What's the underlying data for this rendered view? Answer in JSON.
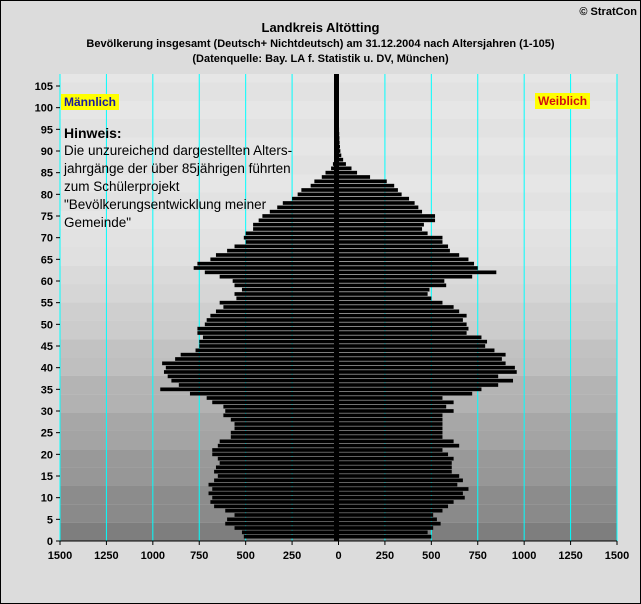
{
  "header": {
    "title": "Landkreis Altötting",
    "subtitle": "Bevölkerung  insgesamt (Deutsch+ Nichtdeutsch) am 31.12.2004 nach Altersjahren (1-105)",
    "source": "(Datenquelle: Bay. LA f. Statistik u. DV, München)",
    "copyright": "© StratCon"
  },
  "labels": {
    "male": "Männlich",
    "female": "Weiblich"
  },
  "note": {
    "heading": "Hinweis:",
    "text": "Die unzureichend dargestellten Alters-jahrgänge der über 85jährigen führten zum Schülerprojekt \"Bevölkerungsentwicklung meiner Gemeinde\""
  },
  "colors": {
    "bars": "#000000",
    "gridlines": "#00ffff",
    "center_axis": "#000000",
    "highlight": "#ffff00"
  },
  "chart_data": {
    "type": "bar",
    "orientation": "horizontal-pyramid",
    "title": "Landkreis Altötting",
    "xlabel": "",
    "ylabel": "",
    "x_ticks": [
      "1500",
      "1250",
      "1000",
      "750",
      "500",
      "250",
      "0",
      "250",
      "500",
      "750",
      "1000",
      "1250",
      "1500"
    ],
    "y_ticks": [
      "0",
      "5",
      "10",
      "15",
      "20",
      "25",
      "30",
      "35",
      "40",
      "45",
      "50",
      "55",
      "60",
      "65",
      "70",
      "75",
      "80",
      "85",
      "90",
      "95",
      "100",
      "105"
    ],
    "xlim": [
      -1500,
      1500
    ],
    "ylim": [
      0,
      105
    ],
    "ages": [
      1,
      2,
      3,
      4,
      5,
      6,
      7,
      8,
      9,
      10,
      11,
      12,
      13,
      14,
      15,
      16,
      17,
      18,
      19,
      20,
      21,
      22,
      23,
      24,
      25,
      26,
      27,
      28,
      29,
      30,
      31,
      32,
      33,
      34,
      35,
      36,
      37,
      38,
      39,
      40,
      41,
      42,
      43,
      44,
      45,
      46,
      47,
      48,
      49,
      50,
      51,
      52,
      53,
      54,
      55,
      56,
      57,
      58,
      59,
      60,
      61,
      62,
      63,
      64,
      65,
      66,
      67,
      68,
      69,
      70,
      71,
      72,
      73,
      74,
      75,
      76,
      77,
      78,
      79,
      80,
      81,
      82,
      83,
      84,
      85,
      86,
      87,
      88,
      89,
      90,
      91,
      92,
      93,
      94,
      95,
      96,
      97,
      98,
      99,
      100,
      101,
      102,
      103,
      104,
      105
    ],
    "series": [
      {
        "name": "Männlich",
        "values": [
          510,
          520,
          560,
          610,
          600,
          560,
          610,
          670,
          690,
          680,
          700,
          680,
          700,
          670,
          650,
          670,
          660,
          640,
          650,
          680,
          680,
          650,
          640,
          580,
          580,
          560,
          560,
          580,
          620,
          610,
          620,
          680,
          710,
          800,
          960,
          860,
          900,
          920,
          940,
          930,
          950,
          880,
          850,
          770,
          750,
          750,
          730,
          760,
          760,
          720,
          710,
          690,
          660,
          620,
          640,
          550,
          560,
          520,
          560,
          570,
          640,
          720,
          780,
          760,
          690,
          660,
          600,
          560,
          500,
          510,
          500,
          460,
          460,
          430,
          410,
          370,
          330,
          300,
          250,
          220,
          200,
          150,
          130,
          90,
          70,
          40,
          30,
          20,
          15,
          10,
          8,
          6,
          5,
          4,
          3,
          2,
          1,
          1,
          0,
          0,
          0,
          0,
          0,
          0,
          0
        ]
      },
      {
        "name": "Weiblich",
        "values": [
          500,
          480,
          510,
          550,
          530,
          510,
          560,
          590,
          620,
          680,
          670,
          700,
          640,
          670,
          650,
          610,
          610,
          610,
          620,
          590,
          560,
          650,
          620,
          560,
          560,
          560,
          560,
          560,
          560,
          620,
          580,
          620,
          560,
          720,
          770,
          860,
          940,
          860,
          960,
          950,
          900,
          880,
          900,
          840,
          790,
          800,
          770,
          690,
          700,
          690,
          670,
          690,
          650,
          620,
          560,
          500,
          480,
          490,
          580,
          570,
          720,
          850,
          750,
          730,
          700,
          650,
          600,
          590,
          560,
          560,
          480,
          450,
          460,
          520,
          520,
          450,
          430,
          410,
          380,
          340,
          320,
          300,
          260,
          170,
          100,
          70,
          40,
          25,
          15,
          10,
          8,
          6,
          5,
          4,
          3,
          2,
          1,
          1,
          0,
          0,
          0,
          0,
          0,
          0,
          0
        ]
      }
    ],
    "grid": true,
    "legend": "none"
  }
}
